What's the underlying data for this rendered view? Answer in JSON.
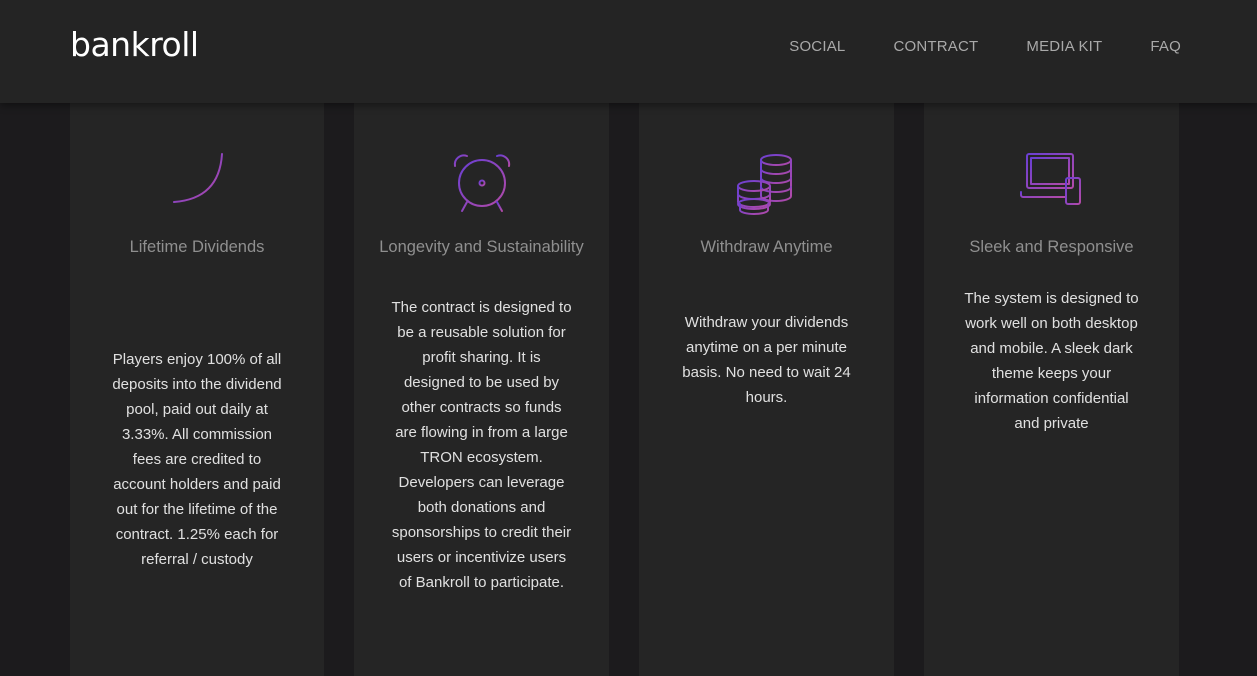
{
  "brand": {
    "logo": "bankroll"
  },
  "nav": [
    "SOCIAL",
    "CONTRACT",
    "MEDIA KIT",
    "FAQ"
  ],
  "colors": {
    "icon_start": "#6a3fd3",
    "icon_end": "#b24aa8"
  },
  "features": [
    {
      "icon": "growth-chart-icon",
      "title": "Lifetime Dividends",
      "description": "Players enjoy 100% of all deposits into the dividend pool, paid out daily at 3.33%. All commission fees are credited to account holders and paid out for the lifetime of the contract. 1.25% each for referral / custody"
    },
    {
      "icon": "alarm-clock-icon",
      "title": "Longevity and Sustainability",
      "description": "The contract is designed to be a reusable solution for profit sharing. It is designed to be used by other contracts so funds are flowing in from a large TRON ecosystem. Developers can leverage both donations and sponsorships to credit their users or incentivize users of Bankroll to participate."
    },
    {
      "icon": "coin-stack-icon",
      "title": "Withdraw Anytime",
      "description": "Withdraw your dividends anytime on a per minute basis. No need to wait 24 hours."
    },
    {
      "icon": "devices-icon",
      "title": "Sleek and Responsive",
      "description": "The system is designed to work well on both desktop and mobile. A sleek dark theme keeps your information confidential and private"
    }
  ]
}
